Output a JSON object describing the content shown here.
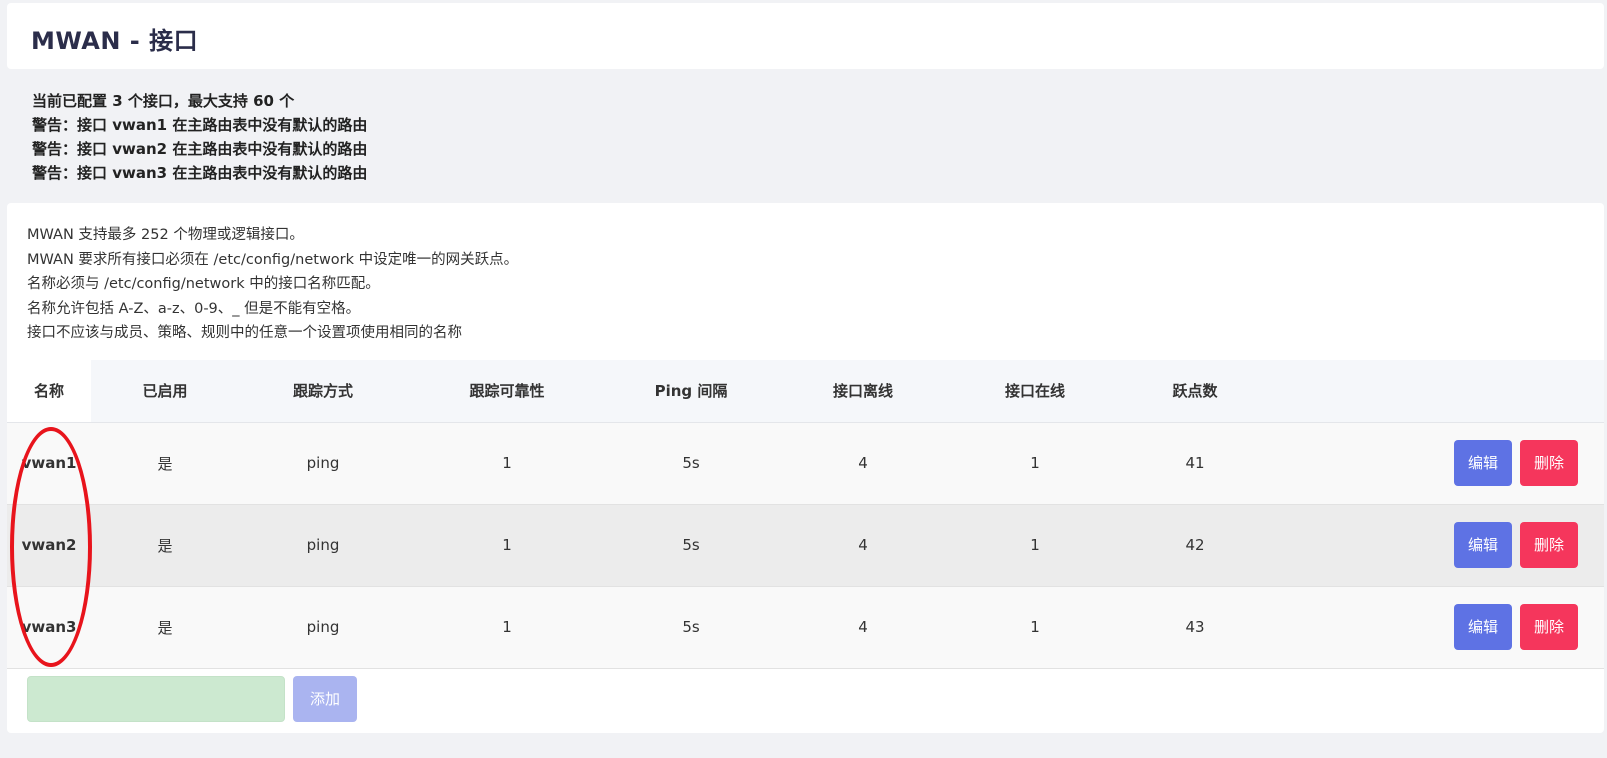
{
  "header": {
    "title": "MWAN - 接口"
  },
  "status": {
    "lines": [
      "当前已配置 3 个接口，最大支持 60 个",
      "警告：接口 vwan1 在主路由表中没有默认的路由",
      "警告：接口 vwan2 在主路由表中没有默认的路由",
      "警告：接口 vwan3 在主路由表中没有默认的路由"
    ]
  },
  "description": {
    "lines": [
      "MWAN 支持最多 252 个物理或逻辑接口。",
      "MWAN 要求所有接口必须在 /etc/config/network 中设定唯一的网关跃点。",
      "名称必须与 /etc/config/network 中的接口名称匹配。",
      "名称允许包括 A-Z、a-z、0-9、_ 但是不能有空格。",
      "接口不应该与成员、策略、规则中的任意一个设置项使用相同的名称"
    ]
  },
  "table": {
    "headers": [
      "名称",
      "已启用",
      "跟踪方式",
      "跟踪可靠性",
      "Ping 间隔",
      "接口离线",
      "接口在线",
      "跃点数"
    ],
    "rows": [
      {
        "name": "vwan1",
        "enabled": "是",
        "track_method": "ping",
        "reliability": "1",
        "ping_interval": "5s",
        "down": "4",
        "up": "1",
        "metric": "41"
      },
      {
        "name": "vwan2",
        "enabled": "是",
        "track_method": "ping",
        "reliability": "1",
        "ping_interval": "5s",
        "down": "4",
        "up": "1",
        "metric": "42"
      },
      {
        "name": "vwan3",
        "enabled": "是",
        "track_method": "ping",
        "reliability": "1",
        "ping_interval": "5s",
        "down": "4",
        "up": "1",
        "metric": "43"
      }
    ],
    "edit_label": "编辑",
    "delete_label": "删除"
  },
  "add": {
    "input_value": "",
    "button_label": "添加"
  },
  "colors": {
    "edit": "#5e72e4",
    "delete": "#f5365c",
    "add_input": "#cce9d0",
    "add_button": "#aab4f0",
    "annotation": "#e8141c"
  }
}
